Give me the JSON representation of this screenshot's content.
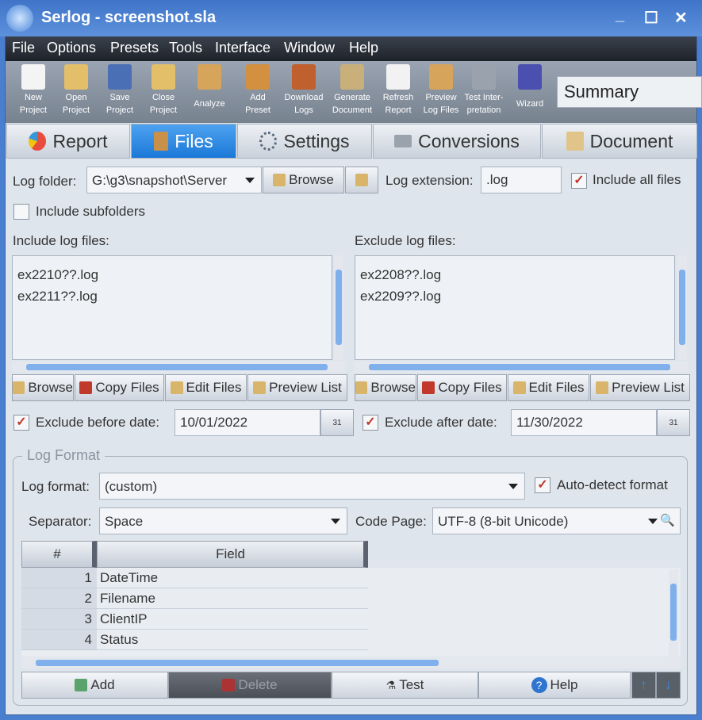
{
  "window": {
    "title": "Serlog - screenshot.sla",
    "min": "_",
    "max": "☐",
    "close": "✕"
  },
  "menu": [
    "File",
    "Options",
    "Presets",
    "Tools",
    "Interface",
    "Window",
    "Help"
  ],
  "toolbar": [
    {
      "l1": "New",
      "l2": "Project",
      "icon": "new-file-icon"
    },
    {
      "l1": "Open",
      "l2": "Project",
      "icon": "open-folder-icon"
    },
    {
      "l1": "Save",
      "l2": "Project",
      "icon": "floppy-icon"
    },
    {
      "l1": "Close",
      "l2": "Project",
      "icon": "close-folder-icon"
    },
    {
      "l1": "Analyze",
      "l2": "",
      "icon": "scroll-magnifier-icon"
    },
    {
      "l1": "Add",
      "l2": "Preset",
      "icon": "stamp-icon"
    },
    {
      "l1": "Download",
      "l2": "Logs",
      "icon": "download-scroll-icon"
    },
    {
      "l1": "Generate",
      "l2": "Document",
      "icon": "gear-scroll-icon"
    },
    {
      "l1": "Refresh",
      "l2": "Report",
      "icon": "refresh-icon"
    },
    {
      "l1": "Preview",
      "l2": "Log Files",
      "icon": "preview-icon"
    },
    {
      "l1": "Test Inter-",
      "l2": "pretation",
      "icon": "microscope-icon"
    },
    {
      "l1": "Wizard",
      "l2": "",
      "icon": "wizard-hat-icon"
    }
  ],
  "summary": "Summary",
  "tabs": [
    "Report",
    "Files",
    "Settings",
    "Conversions",
    "Document"
  ],
  "files": {
    "log_folder_label": "Log folder:",
    "log_folder": "G:\\g3\\snapshot\\Server",
    "browse": "Browse",
    "log_ext_label": "Log extension:",
    "log_ext": ".log",
    "include_all": "Include all files",
    "include_all_checked": true,
    "include_sub": "Include subfolders",
    "include_sub_checked": false,
    "include_label": "Include log files:",
    "include": [
      "ex2210??.log",
      "ex2211??.log"
    ],
    "exclude_label": "Exclude log files:",
    "exclude": [
      "ex2208??.log",
      "ex2209??.log"
    ],
    "list_buttons": [
      "Browse",
      "Copy Files",
      "Edit Files",
      "Preview List"
    ],
    "excl_before_label": "Exclude before date:",
    "excl_before": "10/01/2022",
    "excl_after_label": "Exclude after date:",
    "excl_after": "11/30/2022",
    "cal": "31"
  },
  "format": {
    "group": "Log Format",
    "log_format_label": "Log format:",
    "log_format": "(custom)",
    "auto_detect": "Auto-detect format",
    "separator_label": "Separator:",
    "separator": "Space",
    "codepage_label": "Code Page:",
    "codepage": "UTF-8 (8-bit Unicode)",
    "col_num": "#",
    "col_field": "Field",
    "rows": [
      {
        "n": "1",
        "f": "DateTime"
      },
      {
        "n": "2",
        "f": "Filename"
      },
      {
        "n": "3",
        "f": "ClientIP"
      },
      {
        "n": "4",
        "f": "Status"
      }
    ],
    "buttons": {
      "add": "Add",
      "delete": "Delete",
      "test": "Test",
      "help": "Help"
    }
  }
}
